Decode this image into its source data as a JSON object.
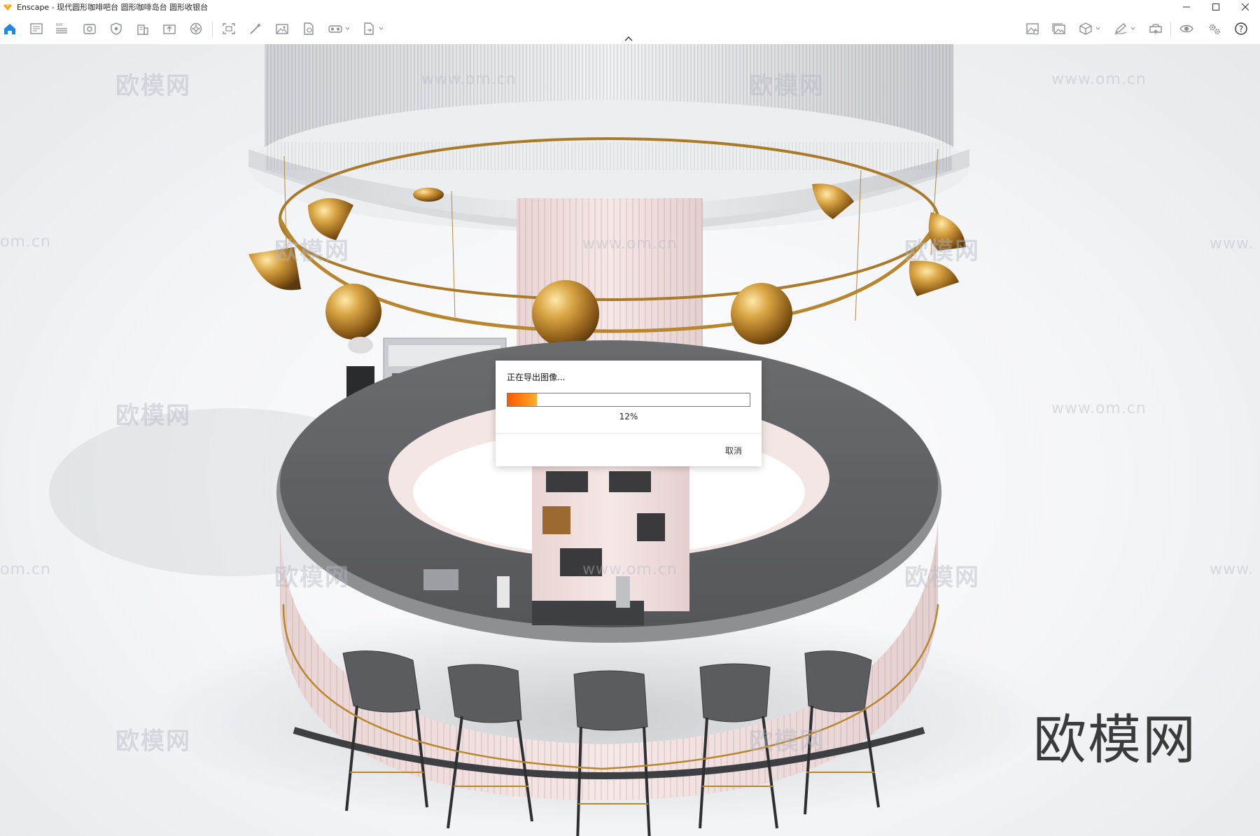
{
  "window": {
    "title": "Enscape - 现代圆形咖啡吧台 圆形咖啡岛台 圆形收银台",
    "controls": [
      "minimize",
      "maximize",
      "close"
    ]
  },
  "toolbar": {
    "left_tools": [
      {
        "icon": "home-icon",
        "active": true
      },
      {
        "icon": "document-list-icon"
      },
      {
        "icon": "bim-list-icon"
      },
      {
        "icon": "view-settings-icon"
      },
      {
        "icon": "shield-icon"
      },
      {
        "icon": "building-icon"
      },
      {
        "icon": "upload-box-icon"
      },
      {
        "icon": "asset-library-icon"
      },
      {
        "icon": "screenshot-frame-icon"
      },
      {
        "icon": "magic-wand-icon"
      },
      {
        "icon": "image-icon"
      },
      {
        "icon": "file-export-icon"
      },
      {
        "icon": "vr-headset-icon",
        "dropdown": true
      },
      {
        "icon": "export-file-icon",
        "dropdown": true
      }
    ],
    "right_tools": [
      {
        "icon": "image-settings-icon"
      },
      {
        "icon": "gallery-icon"
      },
      {
        "icon": "cube-icon",
        "dropdown": true
      },
      {
        "icon": "pen-icon",
        "dropdown": true
      },
      {
        "icon": "camera-upload-icon"
      },
      {
        "icon": "eye-icon"
      },
      {
        "icon": "gears-icon"
      },
      {
        "icon": "help-icon"
      }
    ]
  },
  "viewport": {
    "watermarks": [
      "欧模网",
      "www.om.cn",
      "om.cn",
      "www."
    ],
    "brand_logo": "欧模网"
  },
  "dialog": {
    "title": "正在导出图像...",
    "progress_percent": 12,
    "progress_label": "12%",
    "cancel_label": "取消"
  },
  "colors": {
    "accent": "#1e88e5",
    "progress_orange": "#ff6a00",
    "counter_grey": "#5f6063",
    "counter_pink": "#f1dcdc",
    "brass": "#b8862f"
  }
}
